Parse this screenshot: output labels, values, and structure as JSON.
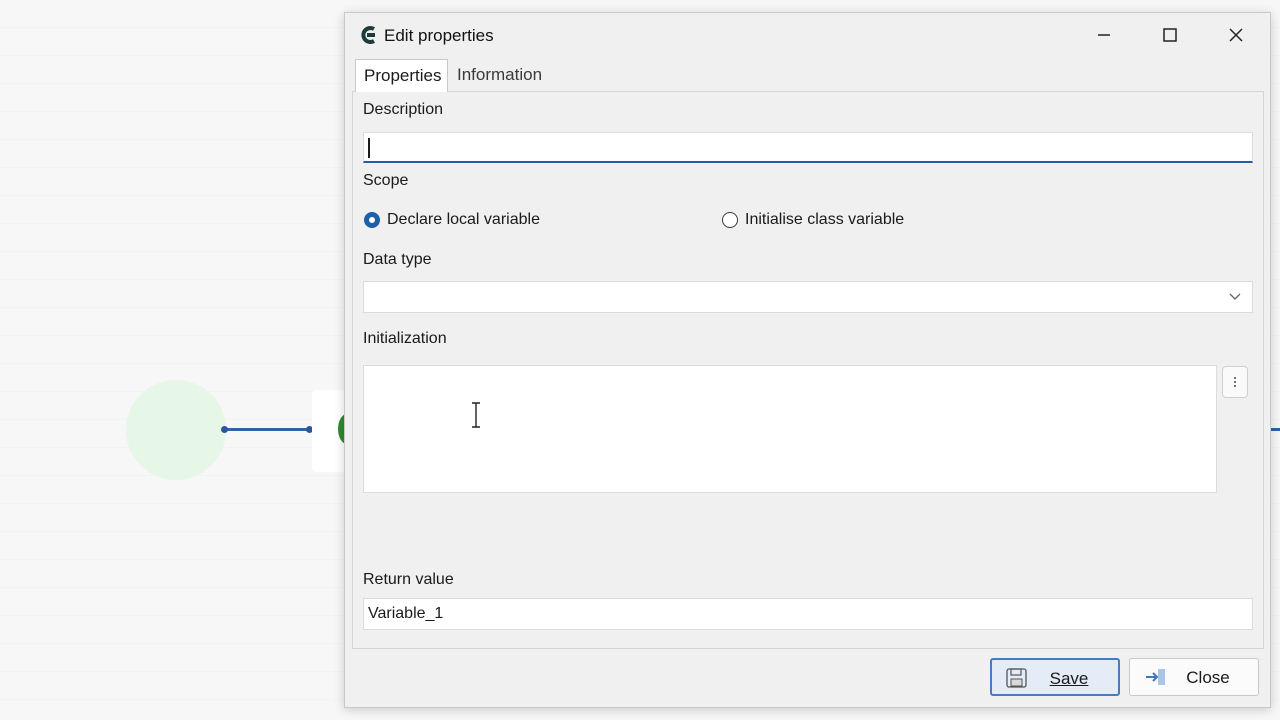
{
  "window": {
    "title": "Edit properties"
  },
  "tabs": [
    {
      "label": "Properties",
      "active": true
    },
    {
      "label": "Information",
      "active": false
    }
  ],
  "form": {
    "description": {
      "label": "Description",
      "value": ""
    },
    "scope": {
      "label": "Scope",
      "options": [
        {
          "label": "Declare local variable",
          "checked": true
        },
        {
          "label": "Initialise class variable",
          "checked": false
        }
      ]
    },
    "data_type": {
      "label": "Data type",
      "value": ""
    },
    "initialization": {
      "label": "Initialization",
      "value": ""
    },
    "return_value": {
      "label": "Return value",
      "value": "Variable_1"
    }
  },
  "buttons": {
    "save": "Save",
    "close": "Close"
  },
  "colors": {
    "accent": "#1f5ea8",
    "connector": "#2f63a6",
    "start_node": "#e6f6e7",
    "node_green": "#2e8b2e"
  }
}
